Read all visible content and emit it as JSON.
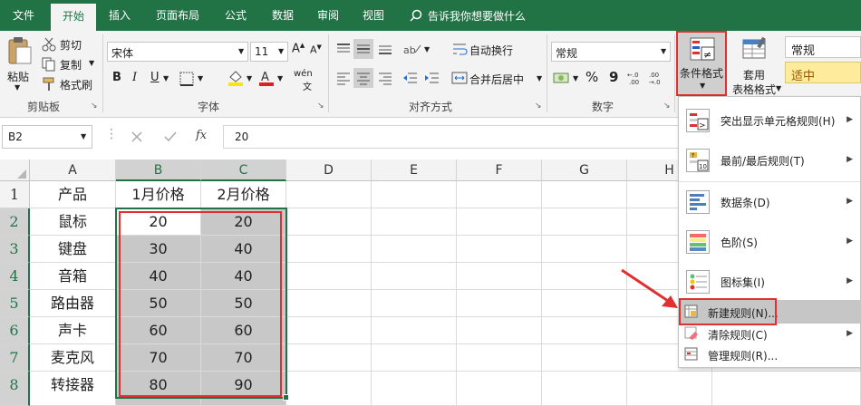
{
  "tabs": [
    "文件",
    "开始",
    "插入",
    "页面布局",
    "公式",
    "数据",
    "审阅",
    "视图"
  ],
  "tell_me": "告诉我你想要做什么",
  "clipboard": {
    "paste": "粘贴",
    "cut": "剪切",
    "copy": "复制",
    "format_painter": "格式刷",
    "label": "剪贴板"
  },
  "font": {
    "name": "宋体",
    "size": "11",
    "bold": "B",
    "italic": "I",
    "underline": "U",
    "wen": "wén",
    "label": "字体"
  },
  "alignment": {
    "wrap": "自动换行",
    "merge": "合并后居中",
    "label": "对齐方式"
  },
  "number": {
    "format": "常规",
    "percent": "%",
    "comma": "9",
    "label": "数字"
  },
  "styles": {
    "conditional": "条件格式",
    "table_format_1": "套用",
    "table_format_2": "表格格式",
    "style_normal": "常规",
    "style_neutral": "适中"
  },
  "formula_bar": {
    "name_box": "B2",
    "fx": "fx",
    "value": "20"
  },
  "columns": [
    "A",
    "B",
    "C",
    "D",
    "E",
    "F",
    "G",
    "H"
  ],
  "rows": [
    "1",
    "2",
    "3",
    "4",
    "5",
    "6",
    "7",
    "8"
  ],
  "sheet": [
    [
      "产品",
      "1月价格",
      "2月价格"
    ],
    [
      "鼠标",
      "20",
      "20"
    ],
    [
      "键盘",
      "30",
      "40"
    ],
    [
      "音箱",
      "40",
      "40"
    ],
    [
      "路由器",
      "50",
      "50"
    ],
    [
      "声卡",
      "60",
      "60"
    ],
    [
      "麦克风",
      "70",
      "70"
    ],
    [
      "转接器",
      "80",
      "90"
    ]
  ],
  "menu": [
    {
      "label": "突出显示单元格规则(H)",
      "arrow": "▶"
    },
    {
      "label": "最前/最后规则(T)",
      "arrow": "▶"
    },
    {
      "label": "数据条(D)",
      "arrow": "▶"
    },
    {
      "label": "色阶(S)",
      "arrow": "▶"
    },
    {
      "label": "图标集(I)",
      "arrow": "▶"
    },
    {
      "label": "新建规则(N)..."
    },
    {
      "label": "清除规则(C)",
      "arrow": "▶"
    },
    {
      "label": "管理规则(R)..."
    }
  ],
  "colors": {
    "excel_green": "#217346",
    "highlight_red": "#e03030",
    "selection_gray": "#c8c8c8",
    "neutral_yellow": "#ffeb9c"
  }
}
